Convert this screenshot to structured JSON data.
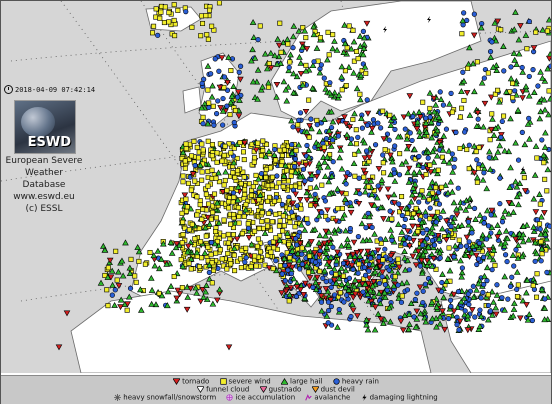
{
  "timestamp": "2018-04-09 07:42:14",
  "logo_text": "ESWD",
  "org": {
    "line1": "European Severe",
    "line2": "Weather Database",
    "url": "www.eswd.eu",
    "copyright": "(c) ESSL"
  },
  "legend": {
    "row1": [
      "tornado",
      "severe wind",
      "large hail",
      "heavy rain"
    ],
    "row2": [
      "funnel cloud",
      "gustnado",
      "dust devil"
    ],
    "row3": [
      "heavy snowfall/snowstorm",
      "ice accumulation",
      "avalanche",
      "damaging lightning"
    ]
  },
  "colors": {
    "sea": "#d6d6d6",
    "land": "#ffffff",
    "tornado": "#d42020",
    "severe_wind": "#f2ee2c",
    "large_hail": "#2eb82e",
    "heavy_rain": "#2a5fd6",
    "funnel_cloud": "#ffffff",
    "gustnado": "#e86a9a",
    "dust_devil": "#f09a1e",
    "snow": "#888888",
    "ice": "#b040c0",
    "avalanche": "#b020b0",
    "lightning": "#000000"
  },
  "icons": {
    "timestamp": "clock-icon",
    "logo": "eswd-globe-logo",
    "tornado": "red-down-triangle-icon",
    "severe_wind": "yellow-square-icon",
    "large_hail": "green-up-triangle-icon",
    "heavy_rain": "blue-circle-icon",
    "funnel_cloud": "white-down-triangle-icon",
    "gustnado": "pink-down-triangle-icon",
    "dust_devil": "orange-down-triangle-icon",
    "snow": "snowflake-icon",
    "ice": "ice-flake-icon",
    "avalanche": "avalanche-icon",
    "lightning": "lightning-bolt-icon"
  }
}
